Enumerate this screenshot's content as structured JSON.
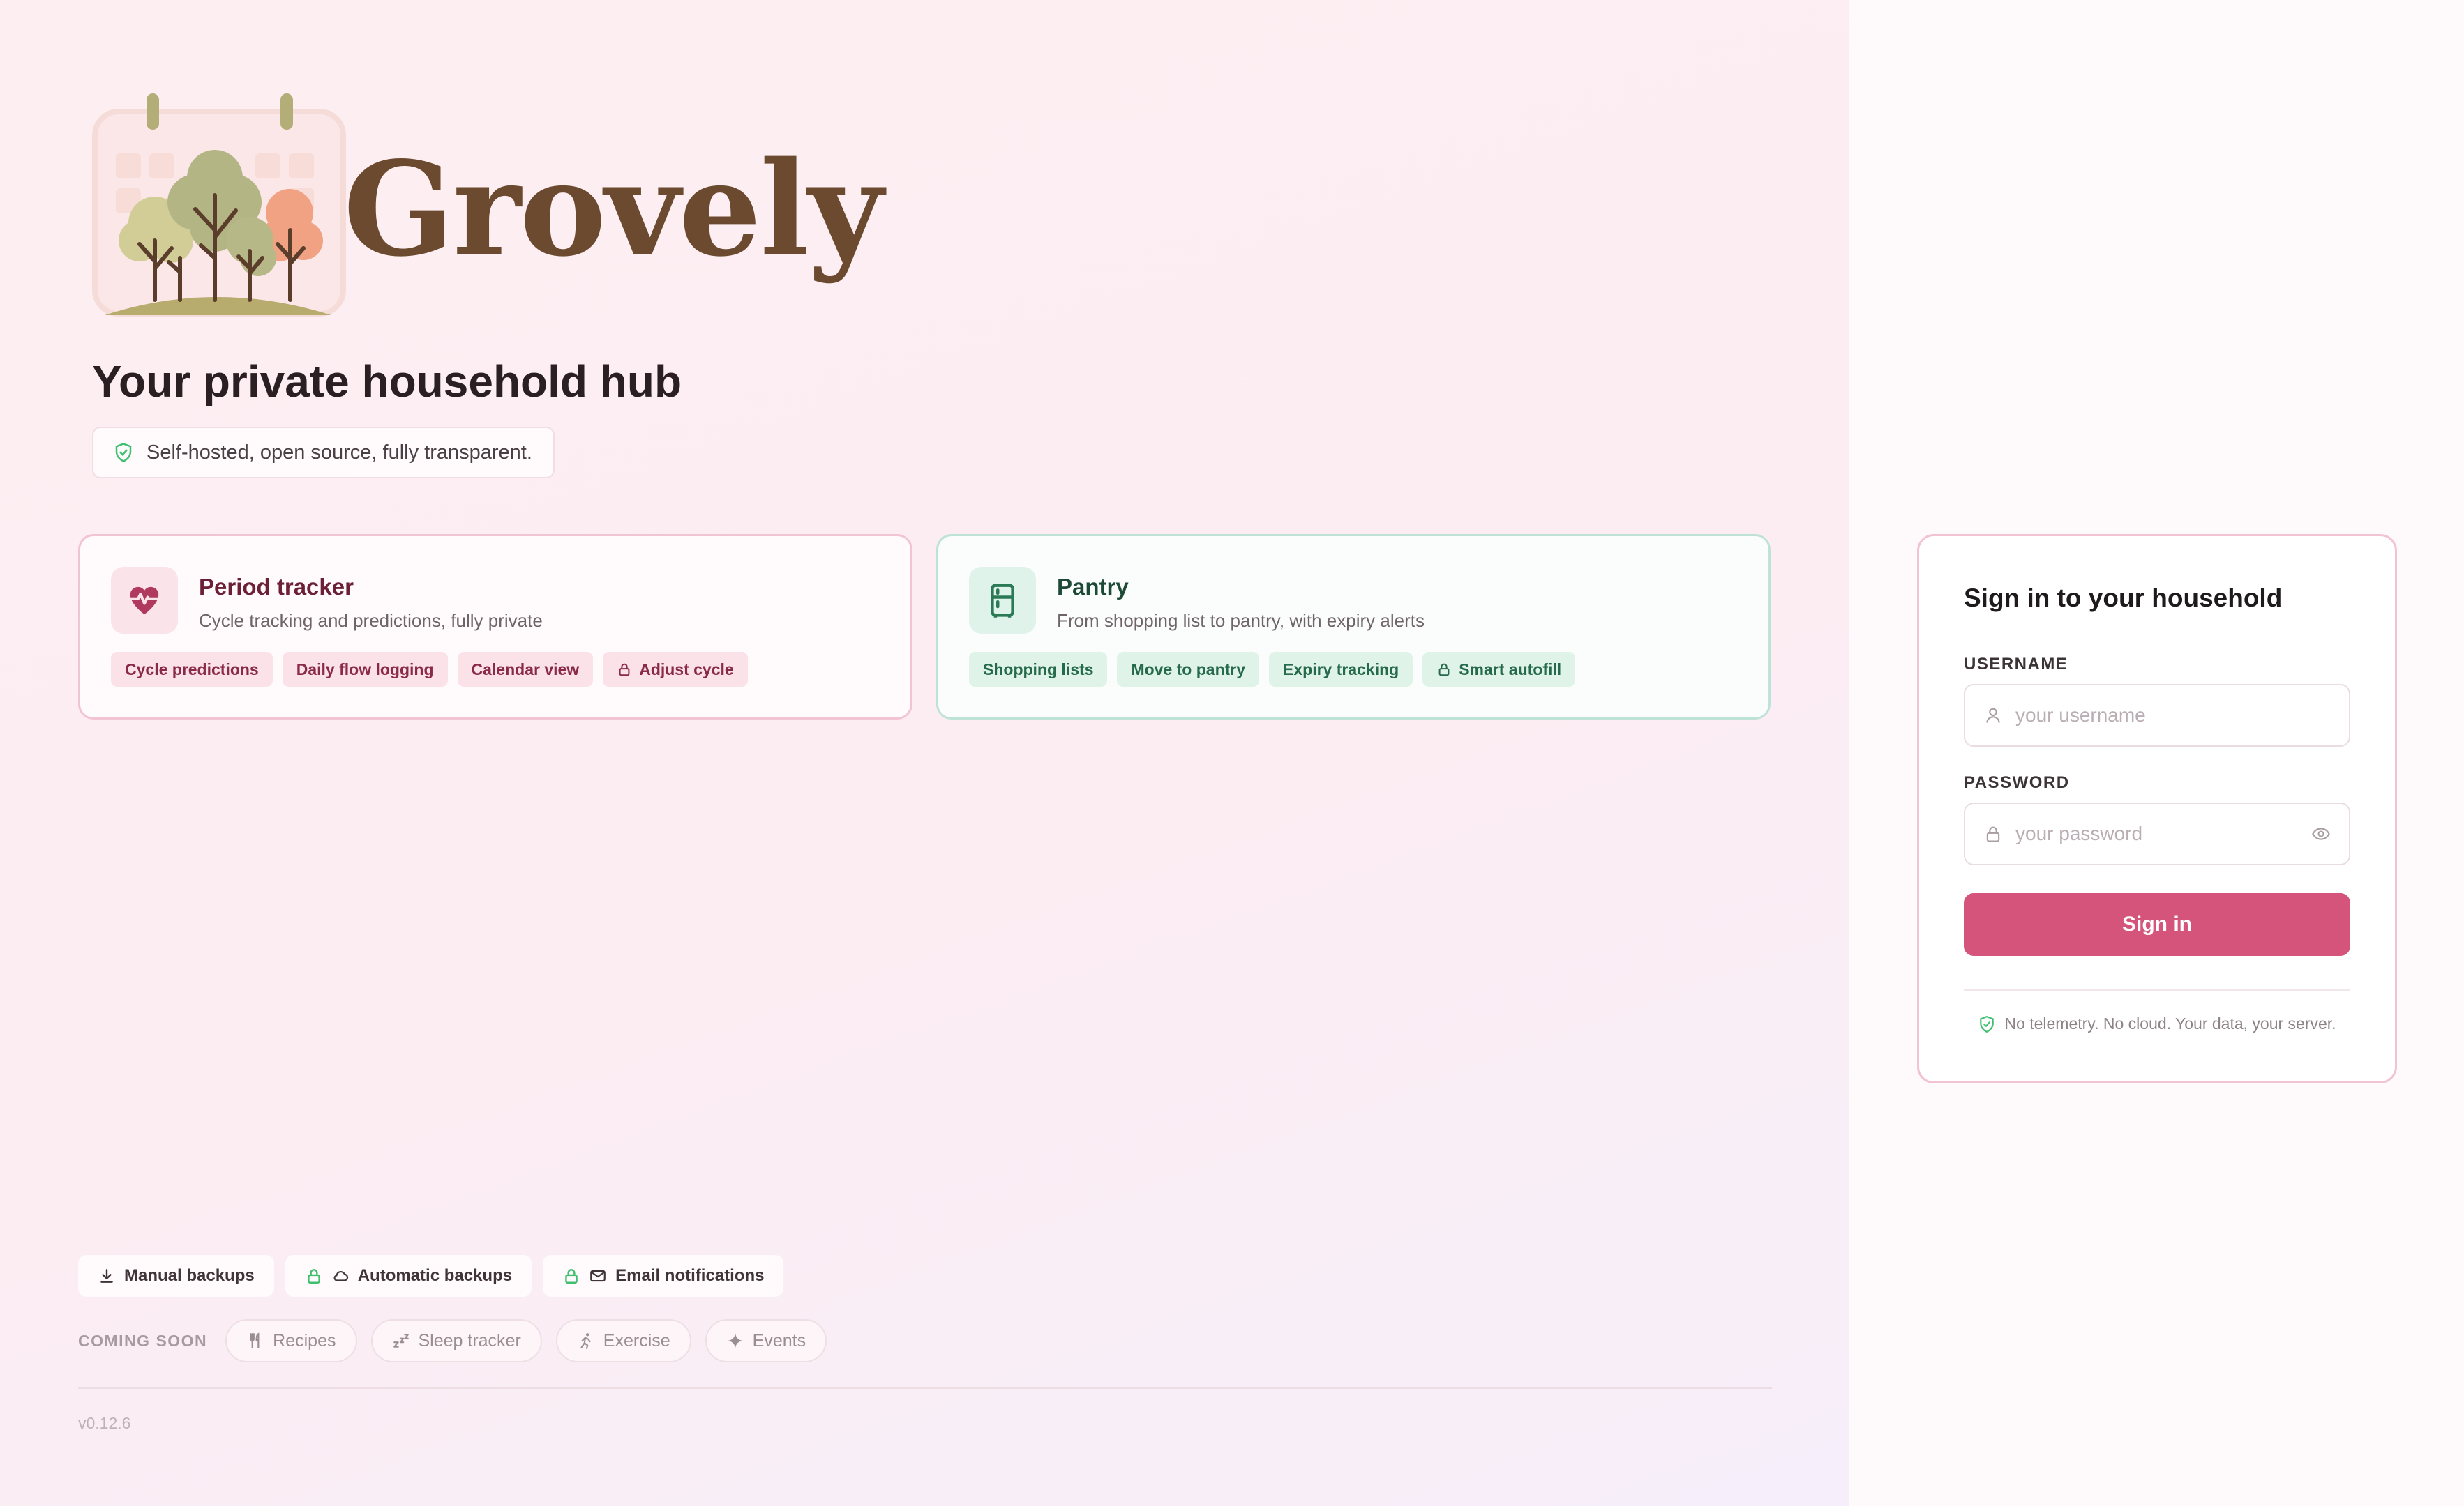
{
  "brand": {
    "name": "Grovely"
  },
  "hero": {
    "headline": "Your private household hub",
    "note": "Self-hosted, open source, fully transparent."
  },
  "modules": [
    {
      "title": "Period tracker",
      "subtitle": "Cycle tracking and predictions, fully private",
      "icon": "heart-pulse-icon",
      "tags": [
        "Cycle predictions",
        "Daily flow logging",
        "Calendar view",
        "Adjust cycle"
      ]
    },
    {
      "title": "Pantry",
      "subtitle": "From shopping list to pantry, with expiry alerts",
      "icon": "fridge-icon",
      "tags": [
        "Shopping lists",
        "Move to pantry",
        "Expiry tracking",
        "Smart autofill"
      ]
    }
  ],
  "features": [
    "Manual backups",
    "Automatic backups",
    "Email notifications"
  ],
  "coming_soon": {
    "label": "COMING SOON",
    "items": [
      "Recipes",
      "Sleep tracker",
      "Exercise",
      "Events"
    ]
  },
  "version": "v0.12.6",
  "login": {
    "title": "Sign in to your household",
    "username_label": "USERNAME",
    "username_placeholder": "your username",
    "password_label": "PASSWORD",
    "password_placeholder": "your password",
    "submit_label": "Sign in",
    "privacy_note": "No telemetry. No cloud. Your data, your server."
  },
  "colors": {
    "accent": "#d4547c",
    "period_tag_bg": "#fbe2e9",
    "pantry_tag_bg": "#e0f3e9",
    "brand_text": "#6b4a2f",
    "shield_green": "#3fbf6f"
  }
}
